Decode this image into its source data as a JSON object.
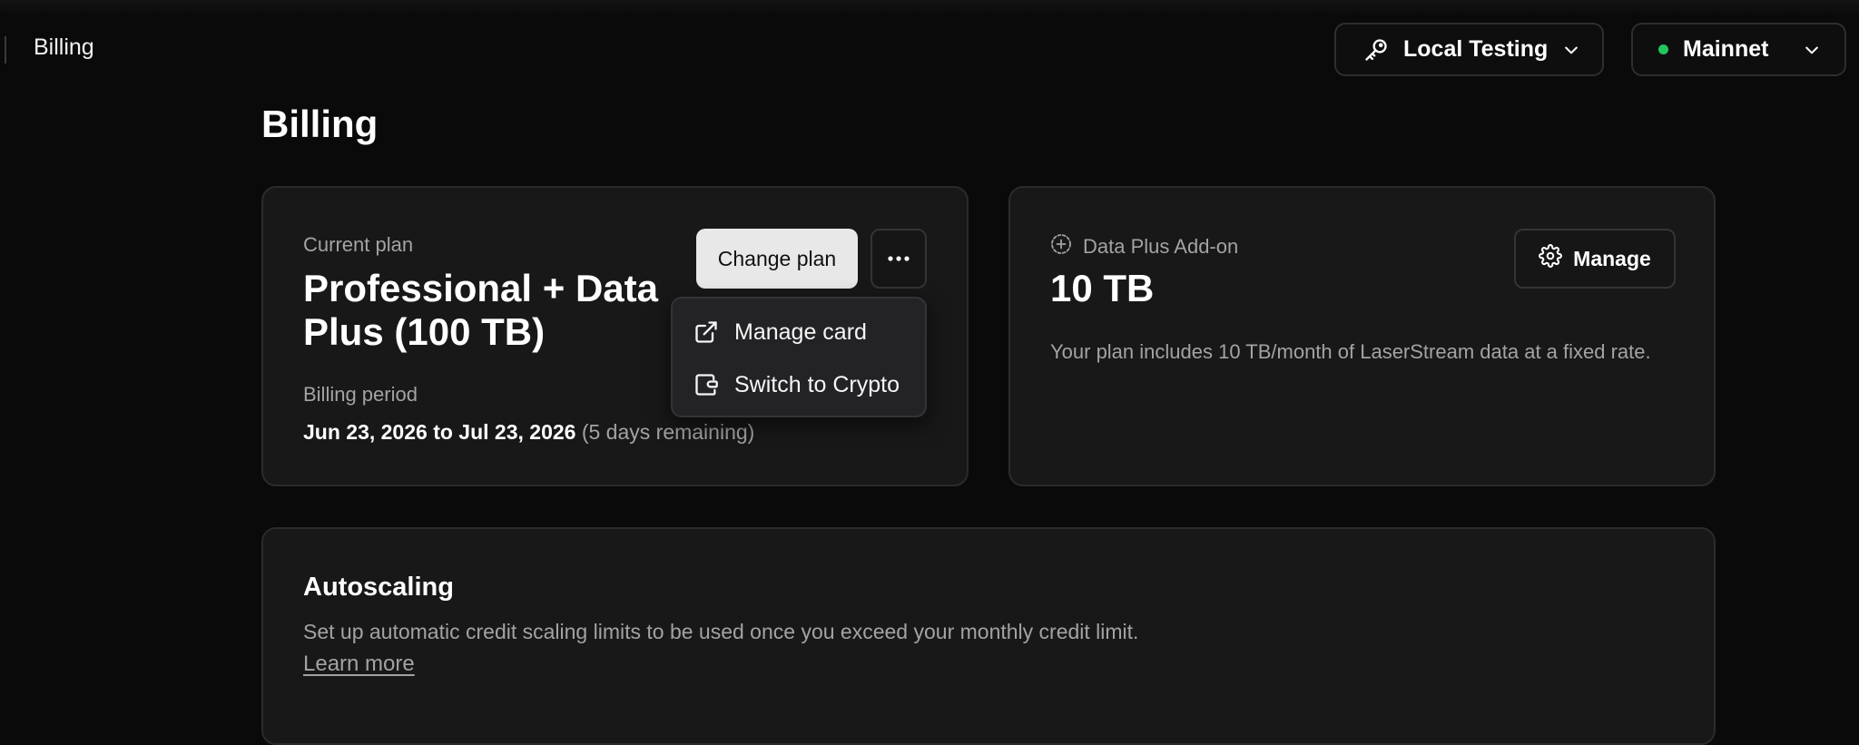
{
  "breadcrumb": {
    "current": "Billing"
  },
  "header": {
    "api_key_selector": {
      "label": "Local Testing",
      "icon": "key-icon"
    },
    "network_selector": {
      "label": "Mainnet",
      "status_color": "#22c55e"
    }
  },
  "page": {
    "title": "Billing"
  },
  "plan_card": {
    "label": "Current plan",
    "plan_name": "Professional + Data Plus (100 TB)",
    "billing_period_label": "Billing period",
    "billing_period": "Jun 23, 2026 to Jul 23, 2026",
    "remaining": "(5 days remaining)",
    "change_plan_label": "Change plan",
    "more_icon": "ellipsis-icon"
  },
  "plan_menu": {
    "items": [
      {
        "label": "Manage card",
        "icon": "external-link-icon"
      },
      {
        "label": "Switch to Crypto",
        "icon": "wallet-icon"
      }
    ]
  },
  "addon_card": {
    "label": "Data Plus Add-on",
    "size": "10 TB",
    "description": "Your plan includes 10 TB/month of LaserStream data at a fixed rate.",
    "manage_label": "Manage"
  },
  "autoscaling": {
    "title": "Autoscaling",
    "description": "Set up automatic credit scaling limits to be used once you exceed your monthly credit limit.",
    "learn_more": "Learn more"
  },
  "colors": {
    "background": "#0a0a0a",
    "card": "#181818",
    "accent_button": "#e8e8e8",
    "status_green": "#22c55e"
  }
}
